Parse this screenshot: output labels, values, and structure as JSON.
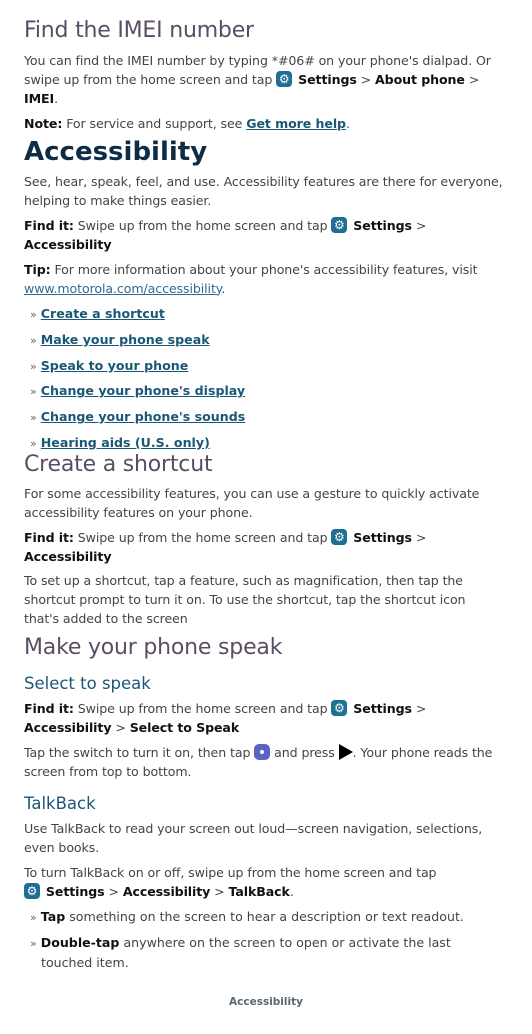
{
  "imei": {
    "title": "Find the IMEI number",
    "para_part1": "You can find the IMEI number by typing *#06# on your phone's dialpad. Or swipe up from the home screen and tap ",
    "settings": "Settings",
    "sep": " > ",
    "about_phone": "About phone",
    "imei": "IMEI",
    "period": ".",
    "note_label": "Note:",
    "note_text": " For service and support, see ",
    "note_link": "Get more help",
    "note_end": "."
  },
  "accessibility": {
    "title": "Accessibility",
    "intro": "See, hear, speak, feel, and use. Accessibility features are there for everyone, helping to make things easier.",
    "findit_label": "Find it:",
    "findit_text": " Swipe up from the home screen and tap ",
    "settings": "Settings",
    "sep": " > ",
    "accessibility": "Accessibility",
    "tip_label": "Tip:",
    "tip_text": " For more information about your phone's accessibility features, visit ",
    "tip_link": "www.motorola.com/accessibility",
    "tip_end": ".",
    "bullet": "»",
    "links": [
      {
        "label": "Create a shortcut"
      },
      {
        "label": "Make your phone speak"
      },
      {
        "label": "Speak to your phone"
      },
      {
        "label": "Change your phone's display"
      },
      {
        "label": "Change your phone's sounds"
      },
      {
        "label": "Hearing aids (U.S. only)"
      }
    ]
  },
  "shortcut": {
    "title": "Create a shortcut",
    "intro": "For some accessibility features, you can use a gesture to quickly activate accessibility features on your phone.",
    "findit_label": "Find it:",
    "findit_text": " Swipe up from the home screen and tap ",
    "settings": "Settings",
    "sep": " > ",
    "accessibility": "Accessibility",
    "body": "To set up a shortcut, tap a feature, such as magnification, then tap the shortcut prompt to turn it on. To use the shortcut, tap the shortcut icon that's added to the screen"
  },
  "speak": {
    "title": "Make your phone speak",
    "sts_title": "Select to speak",
    "findit_label": "Find it:",
    "findit_text": " Swipe up from the home screen and tap ",
    "settings": "Settings",
    "sep": " > ",
    "accessibility": "Accessibility",
    "select_to_speak": "Select to Speak",
    "tap_text1": "Tap the switch to turn it on, then tap ",
    "tap_text2": " and press ",
    "tap_text3": ". Your phone reads the screen from top to bottom.",
    "talkback_title": "TalkBack",
    "talkback_intro": "Use TalkBack to read your screen out loud—screen navigation, selections, even books.",
    "talkback_turn": "To turn TalkBack on or off, swipe up from the home screen and tap ",
    "talkback": "TalkBack",
    "period": ".",
    "bullet": "»",
    "bullets": [
      {
        "bold": "Tap",
        "text": " something on the screen to hear a description or text readout."
      },
      {
        "bold": "Double-tap",
        "text": " anywhere on the screen to open or activate the last touched item."
      }
    ]
  },
  "footer": {
    "label": "Accessibility"
  }
}
